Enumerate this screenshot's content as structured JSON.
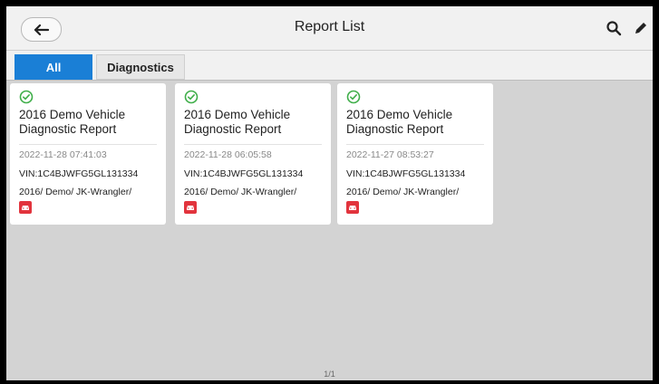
{
  "header": {
    "title": "Report List",
    "back_icon": "arrow-left-icon",
    "search_icon": "search-icon",
    "edit_icon": "pencil-icon"
  },
  "tabs": [
    {
      "label": "All",
      "active": true
    },
    {
      "label": "Diagnostics",
      "active": false
    }
  ],
  "reports": [
    {
      "title_line1": "2016 Demo Vehicle",
      "title_line2": "Diagnostic Report",
      "date": "2022-11-28 07:41:03",
      "vin": "VIN:1C4BJWFG5GL131334",
      "path": "2016/ Demo/ JK-Wrangler/",
      "status_icon": "check-circle-icon",
      "vehicle_icon": "car-icon"
    },
    {
      "title_line1": "2016 Demo Vehicle",
      "title_line2": "Diagnostic Report",
      "date": "2022-11-28 06:05:58",
      "vin": "VIN:1C4BJWFG5GL131334",
      "path": "2016/ Demo/ JK-Wrangler/",
      "status_icon": "check-circle-icon",
      "vehicle_icon": "car-icon"
    },
    {
      "title_line1": "2016 Demo Vehicle",
      "title_line2": "Diagnostic Report",
      "date": "2022-11-27 08:53:27",
      "vin": "VIN:1C4BJWFG5GL131334",
      "path": "2016/ Demo/ JK-Wrangler/",
      "status_icon": "check-circle-icon",
      "vehicle_icon": "car-icon"
    }
  ],
  "pagination": {
    "text": "1/1"
  },
  "colors": {
    "accent": "#1a7fd6",
    "success": "#3fae49",
    "vehicle_badge": "#e2343d",
    "background": "#d3d3d3"
  }
}
